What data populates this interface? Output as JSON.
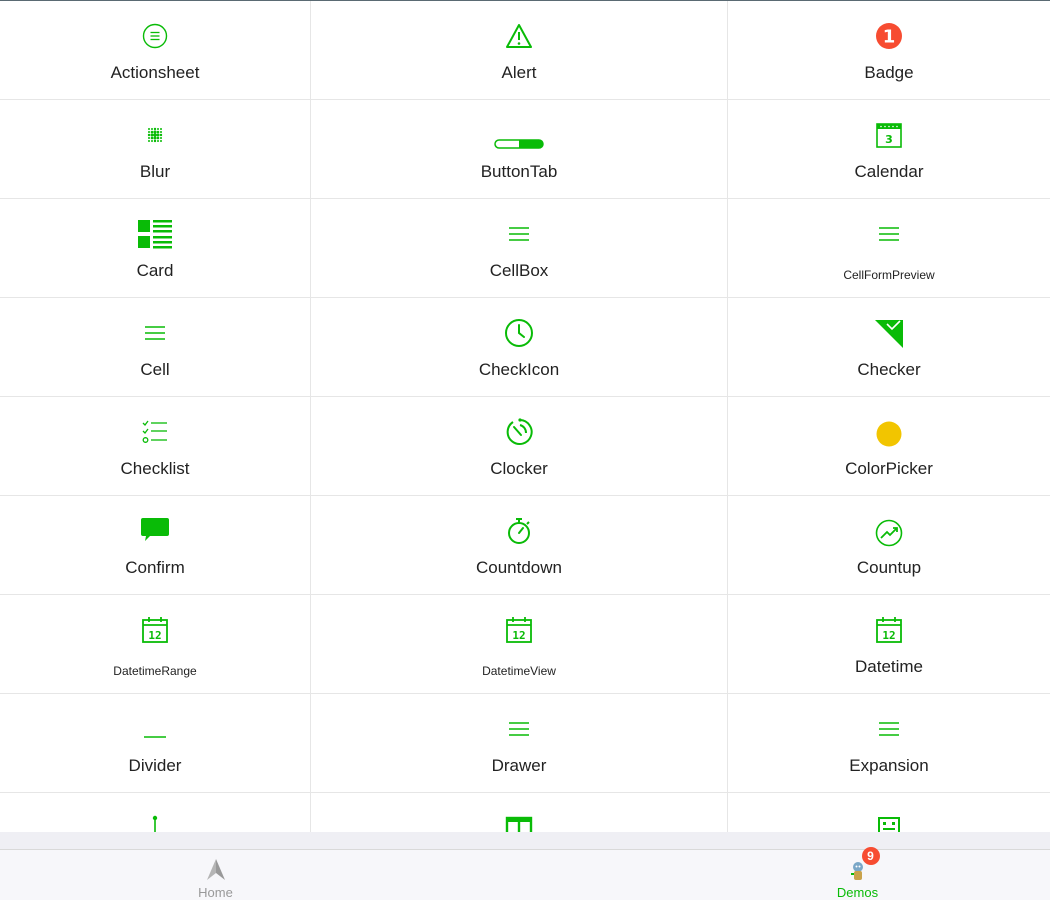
{
  "colors": {
    "accent": "#09bb07",
    "badge": "#f74c31",
    "yellow": "#f2c500",
    "tab_inactive": "#999999"
  },
  "items": [
    {
      "label": "Actionsheet",
      "icon": "actionsheet-icon"
    },
    {
      "label": "Alert",
      "icon": "alert-icon"
    },
    {
      "label": "Badge",
      "icon": "badge-icon",
      "badge_text": "1"
    },
    {
      "label": "Blur",
      "icon": "blur-icon"
    },
    {
      "label": "ButtonTab",
      "icon": "buttontab-icon"
    },
    {
      "label": "Calendar",
      "icon": "calendar-icon",
      "calendar_day": "3"
    },
    {
      "label": "Card",
      "icon": "card-icon"
    },
    {
      "label": "CellBox",
      "icon": "menu-icon"
    },
    {
      "label": "CellFormPreview",
      "icon": "menu-icon"
    },
    {
      "label": "Cell",
      "icon": "menu-icon"
    },
    {
      "label": "CheckIcon",
      "icon": "clock-icon"
    },
    {
      "label": "Checker",
      "icon": "checker-icon"
    },
    {
      "label": "Checklist",
      "icon": "checklist-icon"
    },
    {
      "label": "Clocker",
      "icon": "clocker-icon"
    },
    {
      "label": "ColorPicker",
      "icon": "color-dot-icon"
    },
    {
      "label": "Confirm",
      "icon": "chat-bubble-icon"
    },
    {
      "label": "Countdown",
      "icon": "stopwatch-icon"
    },
    {
      "label": "Countup",
      "icon": "trend-up-icon"
    },
    {
      "label": "DatetimeRange",
      "icon": "date-icon",
      "date_number": "12"
    },
    {
      "label": "DatetimeView",
      "icon": "date-icon",
      "date_number": "12"
    },
    {
      "label": "Datetime",
      "icon": "date-icon",
      "date_number": "12"
    },
    {
      "label": "Divider",
      "icon": "divider-icon"
    },
    {
      "label": "Drawer",
      "icon": "menu-icon"
    },
    {
      "label": "Expansion",
      "icon": "menu-icon"
    },
    {
      "label": "",
      "icon": "pin-icon"
    },
    {
      "label": "",
      "icon": "panel-icon"
    },
    {
      "label": "",
      "icon": "robot-icon"
    }
  ],
  "tabbar": {
    "home_label": "Home",
    "home_icon": "navigation-arrow-icon",
    "demos_label": "Demos",
    "demos_icon": "demos-icon",
    "demos_badge": "9"
  }
}
